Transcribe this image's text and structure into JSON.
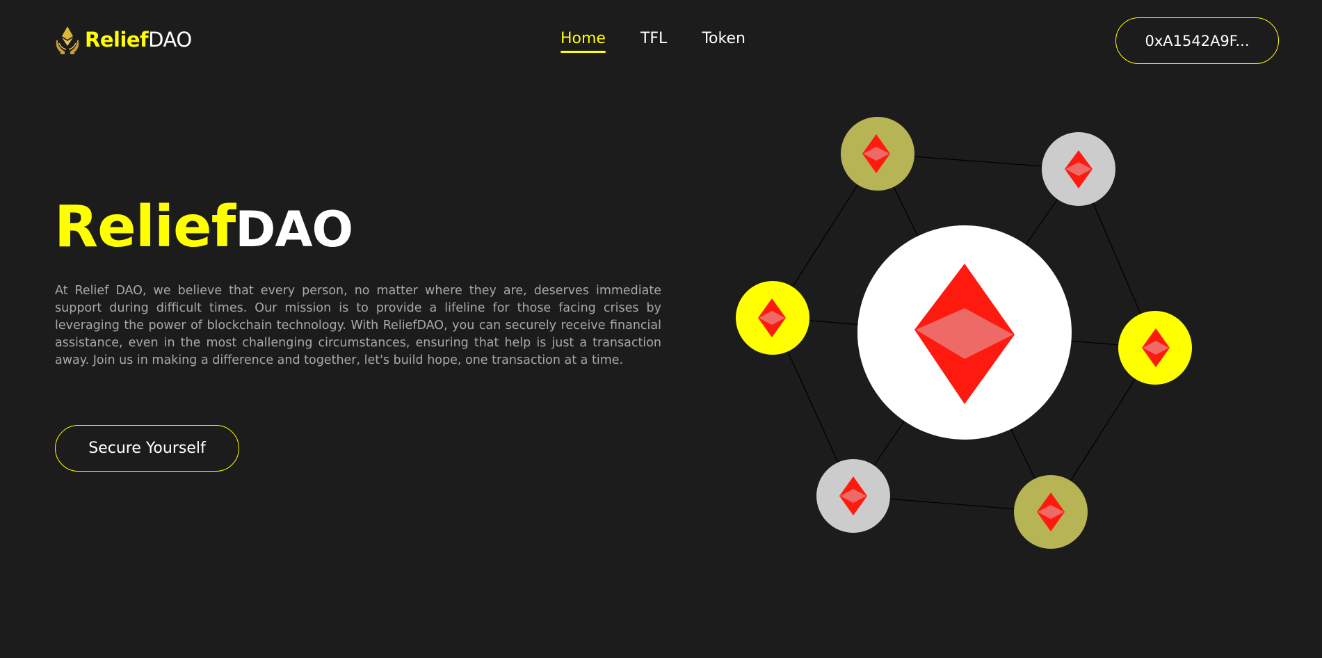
{
  "brand": {
    "name_highlight": "Relief",
    "name_rest": "DAO",
    "logo_icon": "hands-holding-ethereum-icon",
    "accent_color": "#ffff00"
  },
  "nav": {
    "items": [
      {
        "label": "Home",
        "active": true
      },
      {
        "label": "TFL",
        "active": false
      },
      {
        "label": "Token",
        "active": false
      }
    ]
  },
  "wallet": {
    "address_label": "0xA1542A9F..."
  },
  "hero": {
    "title_highlight": "Relief",
    "title_rest": "DAO",
    "description": "At Relief DAO, we believe that every person, no matter where they are, deserves immediate support during difficult times. Our mission is to provide a lifeline for those facing crises by leveraging the power of blockchain technology. With ReliefDAO, you can securely receive financial assistance, even in the most challenging circumstances, ensuring that help is just a transaction away. Join us in making a difference and together, let's build hope, one transaction at a time.",
    "cta_label": "Secure Yourself"
  },
  "illustration": {
    "center_icon": "ethereum-diamond-icon",
    "node_icon": "ethereum-diamond-icon",
    "colors": {
      "background": "#1c1c1c",
      "center": "#ffffff",
      "olive": "#b6b455",
      "gray": "#cccccc",
      "yellow": "#ffff00",
      "diamond": "#ff1a0f",
      "diamond_highlight": "#ee6a66",
      "link": "#000000"
    }
  }
}
